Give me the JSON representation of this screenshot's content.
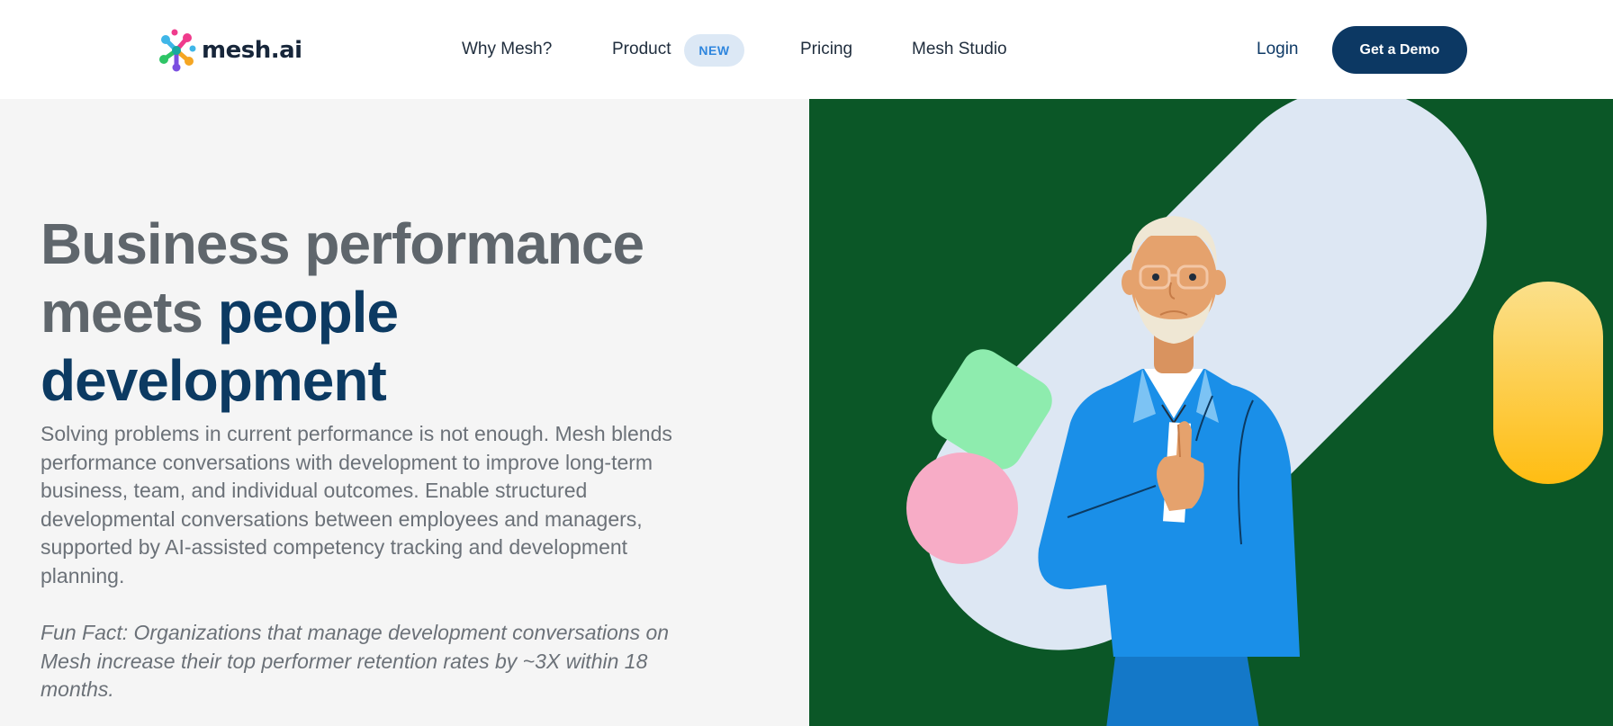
{
  "nav": {
    "logo_text": "mesh.ai",
    "links": [
      "Why Mesh?",
      "Product",
      "Pricing",
      "Mesh Studio"
    ],
    "product_badge": "NEW",
    "login": "Login",
    "cta": "Get a Demo"
  },
  "hero": {
    "headline_grey": "Business performance meets ",
    "headline_accent": "people development",
    "paragraph": "Solving problems in current performance is not enough. Mesh blends performance conversations with development to improve long-term business, team, and individual outcomes. Enable structured developmental conversations between employees and managers, supported by AI-assisted competency tracking and development planning.",
    "fun_fact": "Fun Fact: Organizations that manage development conversations on Mesh increase their top performer retention rates by ~3X within 18 months."
  },
  "illustration": {
    "name": "man-thumbs-up-illustration",
    "background": "#0b5727",
    "colors": {
      "capsule": "#dde7f3",
      "green_square": "#8eecae",
      "pink_circle": "#f7acc6",
      "yellow_pill_top": "#fbe08b",
      "yellow_pill_bottom": "#ffbd12",
      "jacket": "#1a8fe8",
      "skin": "#e5a26d",
      "hair": "#efe7d4"
    }
  },
  "colors": {
    "brand_dark": "#0c3863",
    "text_grey": "#5f666c",
    "badge_bg": "#dce8f5",
    "badge_text": "#2f86de"
  }
}
